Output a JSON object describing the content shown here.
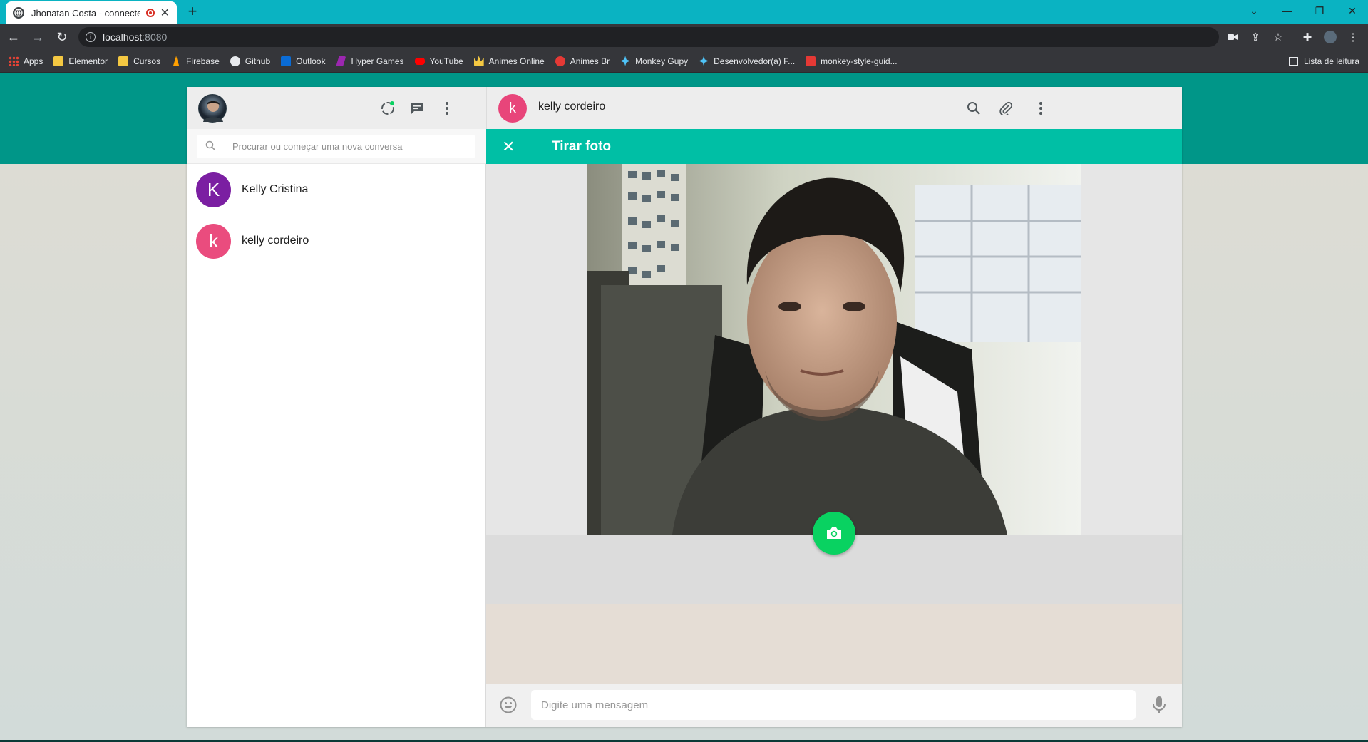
{
  "browser": {
    "tab_title": "Jhonatan Costa - connected",
    "new_tab": "+",
    "url_host": "localhost",
    "url_port": ":8080",
    "bookmarks": [
      {
        "label": "Apps",
        "color": "#e8eaed"
      },
      {
        "label": "Elementor",
        "color": "#f4c842"
      },
      {
        "label": "Cursos",
        "color": "#f4c842"
      },
      {
        "label": "Firebase",
        "color": "#ffa000"
      },
      {
        "label": "Github",
        "color": "#e8eaed"
      },
      {
        "label": "Outlook",
        "color": "#0a6cd6"
      },
      {
        "label": "Hyper Games",
        "color": "#9c27b0"
      },
      {
        "label": "YouTube",
        "color": "#ff0000"
      },
      {
        "label": "Animes Online",
        "color": "#f4c842"
      },
      {
        "label": "Animes Br",
        "color": "#e53935"
      },
      {
        "label": "Monkey Gupy",
        "color": "#4fc3f7"
      },
      {
        "label": "Desenvolvedor(a) F...",
        "color": "#4fc3f7"
      },
      {
        "label": "monkey-style-guid...",
        "color": "#e53935"
      }
    ],
    "reading_list": "Lista de leitura"
  },
  "sidebar": {
    "search_placeholder": "Procurar ou começar uma nova conversa",
    "contacts": [
      {
        "initial": "K",
        "name": "Kelly Cristina",
        "color": "#7b1fa2"
      },
      {
        "initial": "k",
        "name": "kelly cordeiro",
        "color": "#ea4c7e"
      }
    ]
  },
  "chat": {
    "initial": "k",
    "name": "kelly cordeiro",
    "panel_title": "Tirar foto",
    "message_placeholder": "Digite uma mensagem"
  },
  "colors": {
    "brand_teal": "#009688",
    "panel_green": "#00bfa5",
    "shutter_green": "#09d261"
  }
}
